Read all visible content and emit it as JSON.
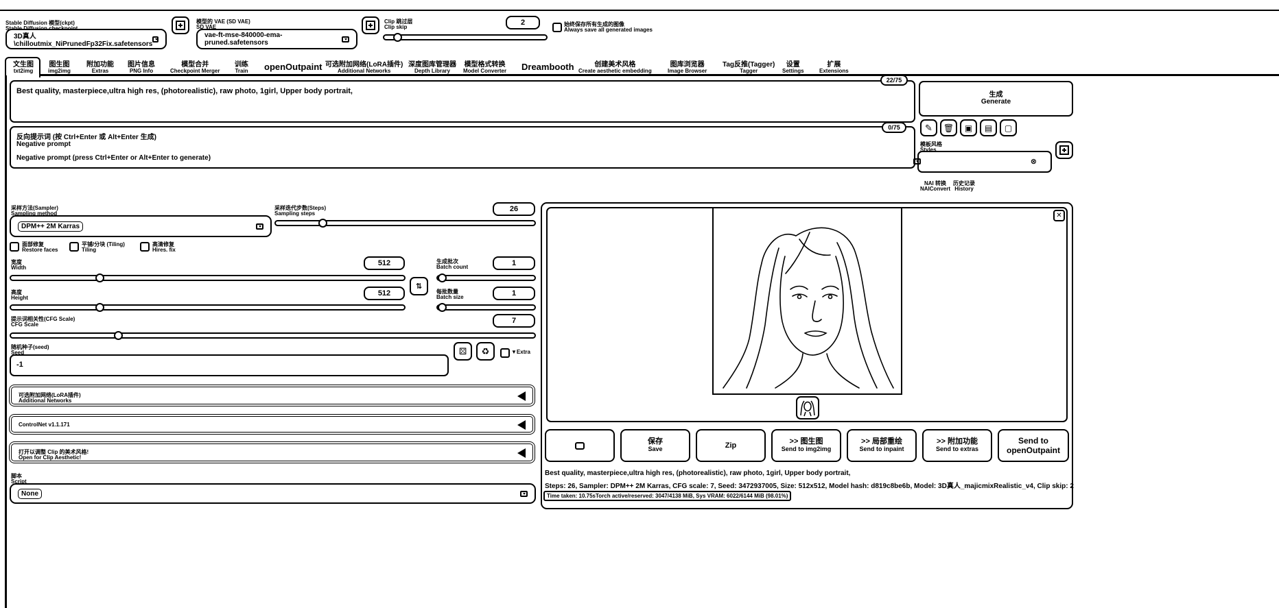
{
  "top": {
    "checkpoint_label_cn": "Stable Diffusion 模型(ckpt)",
    "checkpoint_label_en": "Stable Diffusion checkpoint",
    "checkpoint_value": "3D真人\\chilloutmix_NiPrunedFp32Fix.safetensors",
    "vae_label_cn": "模型的 VAE (SD VAE)",
    "vae_label_en": "SD VAE",
    "vae_value": "vae-ft-mse-840000-ema-pruned.safetensors",
    "clip_label_cn": "Clip 跳过层",
    "clip_label_en": "Clip skip",
    "clip_value": "2",
    "clip_fraction": 0.06,
    "save_all_cn": "始终保存所有生成的图像",
    "save_all_en": "Always save all generated images"
  },
  "tabs": [
    {
      "cn": "文生图",
      "en": "txt2img"
    },
    {
      "cn": "图生图",
      "en": "img2img"
    },
    {
      "cn": "附加功能",
      "en": "Extras"
    },
    {
      "cn": "图片信息",
      "en": "PNG Info"
    },
    {
      "cn": "模型合并",
      "en": "Checkpoint Merger"
    },
    {
      "cn": "训练",
      "en": "Train"
    },
    {
      "cn": "openOutpaint",
      "en": ""
    },
    {
      "cn": "可选附加网络(LoRA插件)",
      "en": "Additional Networks"
    },
    {
      "cn": "深度图库管理器",
      "en": "Depth Library"
    },
    {
      "cn": "模型格式转换",
      "en": "Model Converter"
    },
    {
      "cn": "Dreambooth",
      "en": ""
    },
    {
      "cn": "创建美术风格",
      "en": "Create aesthetic embedding"
    },
    {
      "cn": "图库浏览器",
      "en": "Image Browser"
    },
    {
      "cn": "Tag反推(Tagger)",
      "en": "Tagger"
    },
    {
      "cn": "设置",
      "en": "Settings"
    },
    {
      "cn": "扩展",
      "en": "Extensions"
    }
  ],
  "prompt": {
    "text": "Best quality, masterpiece,ultra high res, (photorealistic), raw photo, 1girl, Upper body portrait,",
    "counter": "22/75"
  },
  "negative": {
    "placeholder_cn": "反向提示词 (按 Ctrl+Enter 或 Alt+Enter 生成)",
    "placeholder_en_title": "Negative prompt",
    "placeholder_en": "Negative prompt (press Ctrl+Enter or Alt+Enter to generate)",
    "counter": "0/75"
  },
  "generate": {
    "cn": "生成",
    "en": "Generate"
  },
  "styles": {
    "cn": "模板风格",
    "en": "Styles"
  },
  "nai": {
    "cn": "NAI 转换",
    "en": "NAIConvert"
  },
  "history": {
    "cn": "历史记录",
    "en": "History"
  },
  "sampler": {
    "label_cn": "采样方法(Sampler)",
    "label_en": "Sampling method",
    "value": "DPM++ 2M Karras"
  },
  "steps": {
    "label_cn": "采样迭代步数(Steps)",
    "label_en": "Sampling steps",
    "value": "26",
    "fraction": 0.17
  },
  "restore_faces": {
    "cn": "面部修复",
    "en": "Restore faces"
  },
  "tiling": {
    "cn": "平铺/分块 (Tiling)",
    "en": "Tiling"
  },
  "hires": {
    "cn": "高清修复",
    "en": "Hires. fix"
  },
  "width": {
    "cn": "宽度",
    "en": "Width",
    "value": "512",
    "fraction": 0.22
  },
  "height": {
    "cn": "高度",
    "en": "Height",
    "value": "512",
    "fraction": 0.22
  },
  "swap": "⇅",
  "batch_count": {
    "cn": "生成批次",
    "en": "Batch count",
    "value": "1",
    "fraction": 0.0
  },
  "batch_size": {
    "cn": "每批数量",
    "en": "Batch size",
    "value": "1",
    "fraction": 0.0
  },
  "cfg": {
    "cn": "提示词相关性(CFG Scale)",
    "en": "CFG Scale",
    "value": "7",
    "fraction": 0.2
  },
  "seed": {
    "cn": "随机种子(seed)",
    "en": "Seed",
    "value": "-1",
    "extra": "Extra"
  },
  "accordions": {
    "networks_cn": "可选附加网络(LoRA插件)",
    "networks_en": "Additional Networks",
    "controlnet": "ControlNet v1.1.171",
    "clip_cn": "打开以调整 Clip 的美术风格!",
    "clip_en": "Open for Clip Aesthetic!"
  },
  "script": {
    "cn": "脚本",
    "en": "Script",
    "value": "None"
  },
  "output_buttons": [
    {
      "cn": "",
      "en": ""
    },
    {
      "cn": "保存",
      "en": "Save"
    },
    {
      "cn": "Zip",
      "en": ""
    },
    {
      "cn": ">> 图生图",
      "en": "Send to img2img"
    },
    {
      "cn": ">> 局部重绘",
      "en": "Send to inpaint"
    },
    {
      "cn": ">> 附加功能",
      "en": "Send to extras"
    },
    {
      "cn": "Send to",
      "en": "openOutpaint"
    }
  ],
  "info": {
    "prompt": "Best quality, masterpiece,ultra high res, (photorealistic), raw photo, 1girl, Upper body portrait,",
    "params": "Steps: 26, Sampler: DPM++ 2M Karras, CFG scale: 7, Seed: 3472937005, Size: 512x512, Model hash: d819c8be6b, Model: 3D真人_majicmixRealistic_v4, Clip skip: 2",
    "time": "Time taken: 10.75sTorch active/reserved: 3047/4138 MiB, Sys VRAM: 6022/6144 MiB (98.01%)"
  }
}
